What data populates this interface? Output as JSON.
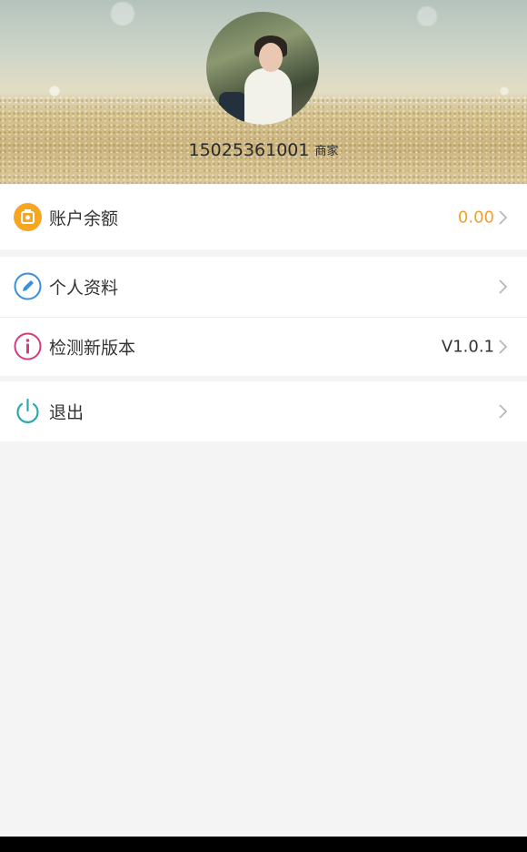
{
  "profile": {
    "phone": "15025361001",
    "role": "商家"
  },
  "menu": {
    "balance": {
      "label": "账户余额",
      "value": "0.00",
      "icon": "wallet-icon"
    },
    "profile": {
      "label": "个人资料",
      "icon": "edit-icon"
    },
    "version": {
      "label": "检测新版本",
      "value": "V1.0.1",
      "icon": "info-icon"
    },
    "logout": {
      "label": "退出",
      "icon": "power-icon"
    }
  },
  "colors": {
    "balance_icon": "#f5a623",
    "balance_value": "#f0a030",
    "edit_icon": "#3a8fd6",
    "info_icon": "#d63a7e",
    "power_icon": "#2aa8b0",
    "chevron": "#b8b8b8"
  }
}
